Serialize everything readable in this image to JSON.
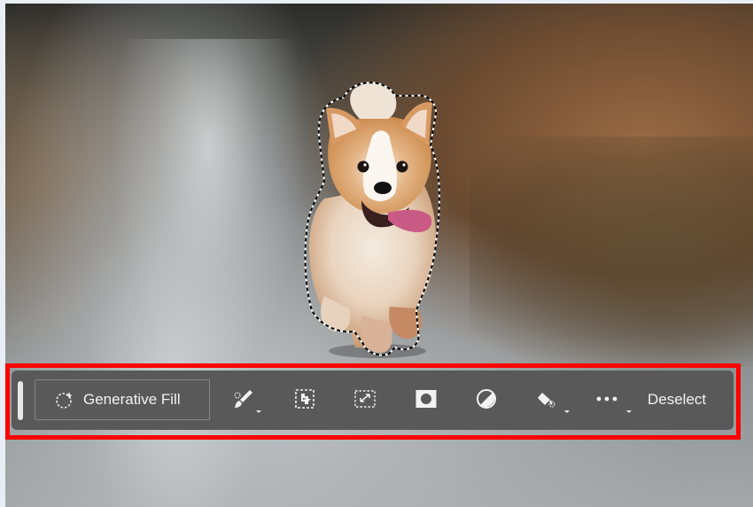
{
  "canvas": {
    "subject": "corgi-running",
    "selection": "marching-ants"
  },
  "contextual_taskbar": {
    "generative_fill_label": "Generative Fill",
    "deselect_label": "Deselect",
    "tools": [
      {
        "icon": "modify-selection-brush-icon",
        "has_dropdown": true
      },
      {
        "icon": "select-subject-icon",
        "has_dropdown": false
      },
      {
        "icon": "transform-selection-icon",
        "has_dropdown": false
      },
      {
        "icon": "create-mask-icon",
        "has_dropdown": false
      },
      {
        "icon": "adjustment-layer-icon",
        "has_dropdown": false
      },
      {
        "icon": "fill-selection-icon",
        "has_dropdown": true
      },
      {
        "icon": "more-options-icon",
        "has_dropdown": true
      }
    ],
    "colors": {
      "bar": "#595959",
      "text": "#f2f2f2",
      "highlight": "#ff0000"
    }
  }
}
